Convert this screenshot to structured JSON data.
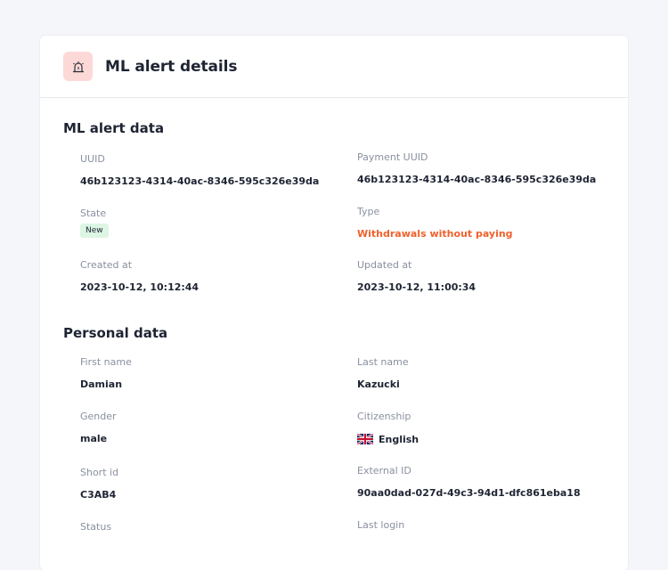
{
  "header": {
    "title": "ML alert details",
    "icon": "alarm-siren-icon"
  },
  "ml_alert": {
    "section_title": "ML alert data",
    "uuid_label": "UUID",
    "uuid_value": "46b123123-4314-40ac-8346-595c326e39da",
    "payment_uuid_label": "Payment UUID",
    "payment_uuid_value": "46b123123-4314-40ac-8346-595c326e39da",
    "state_label": "State",
    "state_value": "New",
    "type_label": "Type",
    "type_value": "Withdrawals without paying",
    "created_label": "Created at",
    "created_value": "2023-10-12, 10:12:44",
    "updated_label": "Updated at",
    "updated_value": "2023-10-12, 11:00:34"
  },
  "personal": {
    "section_title": "Personal data",
    "first_name_label": "First name",
    "first_name_value": "Damian",
    "last_name_label": "Last name",
    "last_name_value": "Kazucki",
    "gender_label": "Gender",
    "gender_value": "male",
    "citizenship_label": "Citizenship",
    "citizenship_value": "English",
    "citizenship_flag": "uk-flag-icon",
    "short_id_label": "Short id",
    "short_id_value": "C3AB4",
    "external_id_label": "External ID",
    "external_id_value": "90aa0dad-027d-49c3-94d1-dfc861eba18",
    "status_label": "Status",
    "last_login_label": "Last login"
  },
  "colors": {
    "accent_alert": "#f0612d",
    "badge_bg": "#dcf6e3",
    "icon_bg": "#fcd9d6"
  }
}
